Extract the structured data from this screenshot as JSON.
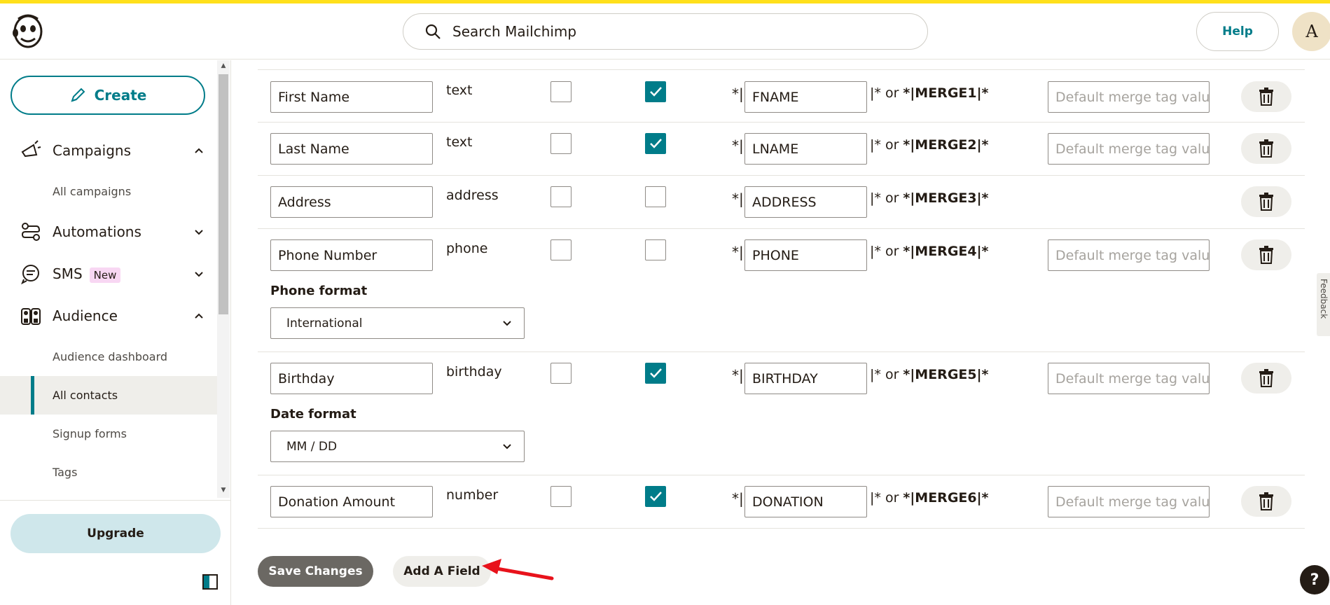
{
  "header": {
    "search_placeholder": "Search Mailchimp",
    "help_label": "Help",
    "avatar_initial": "A",
    "accent_color": "#ffe01b"
  },
  "sidebar": {
    "create_label": "Create",
    "campaigns_label": "Campaigns",
    "all_campaigns_label": "All campaigns",
    "automations_label": "Automations",
    "sms_label": "SMS",
    "sms_badge": "New",
    "audience_label": "Audience",
    "audience_dashboard_label": "Audience dashboard",
    "all_contacts_label": "All contacts",
    "signup_forms_label": "Signup forms",
    "tags_label": "Tags",
    "upgrade_label": "Upgrade"
  },
  "fields": [
    {
      "name": "First Name",
      "type": "text",
      "required": false,
      "visible": true,
      "tag": "FNAME",
      "merge": "*|MERGE1|*",
      "default_placeholder": "Default merge tag value"
    },
    {
      "name": "Last Name",
      "type": "text",
      "required": false,
      "visible": true,
      "tag": "LNAME",
      "merge": "*|MERGE2|*",
      "default_placeholder": "Default merge tag value"
    },
    {
      "name": "Address",
      "type": "address",
      "required": false,
      "visible": false,
      "tag": "ADDRESS",
      "merge": "*|MERGE3|*"
    },
    {
      "name": "Phone Number",
      "type": "phone",
      "required": false,
      "visible": false,
      "tag": "PHONE",
      "merge": "*|MERGE4|*",
      "default_placeholder": "Default merge tag value",
      "format_label": "Phone format",
      "format_value": "International"
    },
    {
      "name": "Birthday",
      "type": "birthday",
      "required": false,
      "visible": true,
      "tag": "BIRTHDAY",
      "merge": "*|MERGE5|*",
      "default_placeholder": "Default merge tag value",
      "format_label": "Date format",
      "format_value": "MM / DD"
    },
    {
      "name": "Donation Amount",
      "type": "number",
      "required": false,
      "visible": true,
      "tag": "DONATION",
      "merge": "*|MERGE6|*",
      "default_placeholder": "Default merge tag value"
    }
  ],
  "tag_prefix": "*|",
  "tag_suffix_a": "|* or ",
  "actions": {
    "save_label": "Save Changes",
    "add_label": "Add A Field"
  },
  "feedback_label": "Feedback",
  "help_fab_label": "?",
  "colors": {
    "teal": "#007c89",
    "upgrade_bg": "#cfe7eb",
    "save_bg": "#6b6863"
  }
}
